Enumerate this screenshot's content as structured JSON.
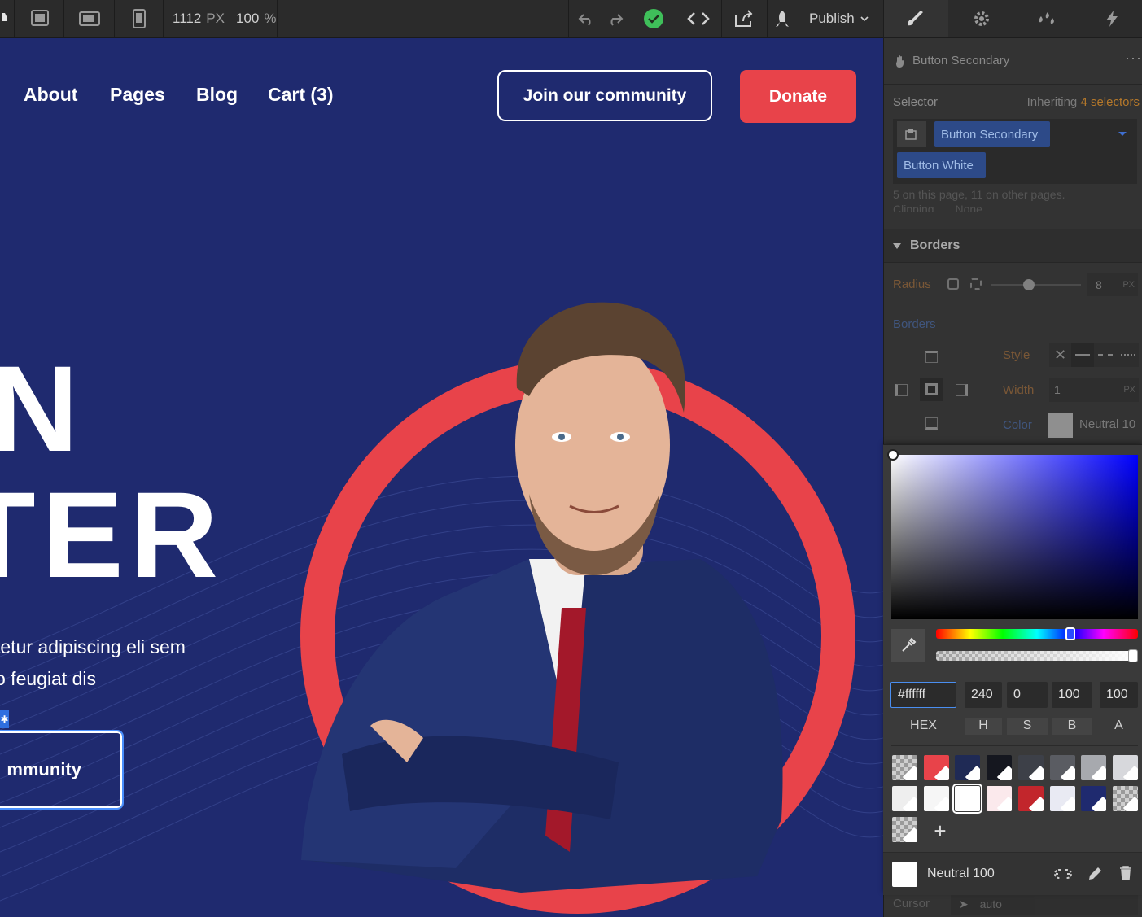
{
  "toolbar": {
    "width_value": "1112",
    "width_unit": "PX",
    "zoom_value": "100",
    "zoom_unit": "%",
    "publish_label": "Publish"
  },
  "site": {
    "nav": [
      "About",
      "Pages",
      "Blog",
      "Cart (3)"
    ],
    "join_button": "Join our community",
    "donate_button": "Donate",
    "hero_line1": "N",
    "hero_line2": "TER",
    "para_line1": "tetur adipiscing eli sem",
    "para_line2": "o feugiat dis",
    "selected_button": "mmunity"
  },
  "panel": {
    "element_name": "Button Secondary",
    "selector_label": "Selector",
    "inheriting_prefix": "Inheriting",
    "inheriting_count": "4 selectors",
    "selector_chips": [
      "Button Secondary",
      "Button White"
    ],
    "usage_text": "5 on this page, 11 on other pages.",
    "clipping_label": "Clipping",
    "clipping_value": "None",
    "borders_section": "Borders",
    "radius_label": "Radius",
    "radius_value": "8",
    "radius_unit": "PX",
    "borders_sub": "Borders",
    "style_label": "Style",
    "width_label": "Width",
    "width_value": "1",
    "width_unit": "PX",
    "color_label": "Color",
    "color_value": "Neutral 10",
    "cursor_label": "Cursor",
    "cursor_value": "auto"
  },
  "picker": {
    "hex": "#ffffff",
    "h": "240",
    "s": "0",
    "b": "100",
    "a": "100",
    "labels": [
      "HEX",
      "H",
      "S",
      "B",
      "A"
    ],
    "hue_fraction": 0.667,
    "swatches_row1": [
      "transparent",
      "#e8434a",
      "#1f2a55",
      "#15171f",
      "#3d4048",
      "#5a5c62",
      "#a7a9ae",
      "#d7d8dc"
    ],
    "swatches_row2": [
      "#eeeeee",
      "#f6f6f6",
      "#ffffff",
      "#fbe9ec",
      "#c2262c",
      "#e9eaf3",
      "#1f2a6f",
      "transparent"
    ],
    "swatch_name": "Neutral 100"
  }
}
